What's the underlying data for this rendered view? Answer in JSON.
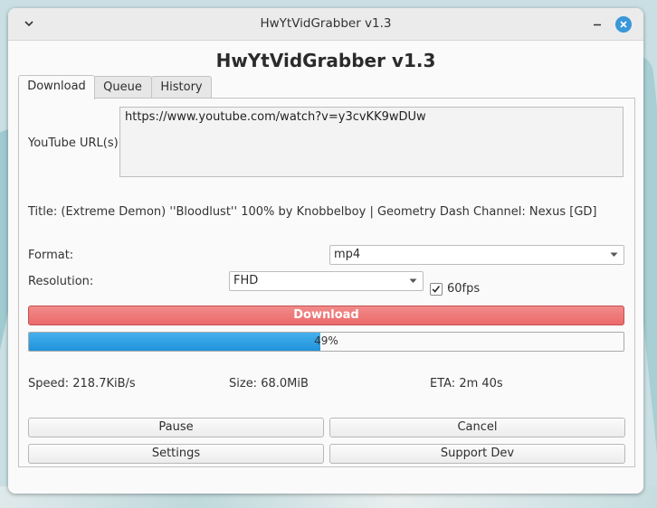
{
  "window": {
    "title": "HwYtVidGrabber v1.3"
  },
  "app": {
    "heading": "HwYtVidGrabber v1.3"
  },
  "tabs": [
    {
      "label": "Download",
      "active": true
    },
    {
      "label": "Queue",
      "active": false
    },
    {
      "label": "History",
      "active": false
    }
  ],
  "download": {
    "url_label": "YouTube URL(s):",
    "url_value": "https://www.youtube.com/watch?v=y3cvKK9wDUw",
    "video_info": "Title: (Extreme Demon) ''Bloodlust'' 100% by Knobbelboy | Geometry Dash  Channel: Nexus [GD]",
    "format_label": "Format:",
    "format_value": "mp4",
    "resolution_label": "Resolution:",
    "resolution_value": "FHD",
    "fps_label": "60fps",
    "fps_checked": true,
    "download_button": "Download",
    "progress_percent": 49,
    "progress_text": "49%",
    "speed": "Speed: 218.7KiB/s",
    "size": "Size: 68.0MiB",
    "eta": "ETA: 2m 40s",
    "pause_button": "Pause",
    "cancel_button": "Cancel",
    "settings_button": "Settings",
    "support_button": "Support Dev"
  },
  "colors": {
    "accent": "#3a97d8",
    "download_button": "#ec6a6a",
    "progress_fill": "#1f93db"
  },
  "icons": {
    "menu": "chevron-down-icon",
    "minimize": "minimize-icon",
    "close": "close-icon",
    "combo": "dropdown-arrow-icon",
    "check": "check-icon"
  }
}
